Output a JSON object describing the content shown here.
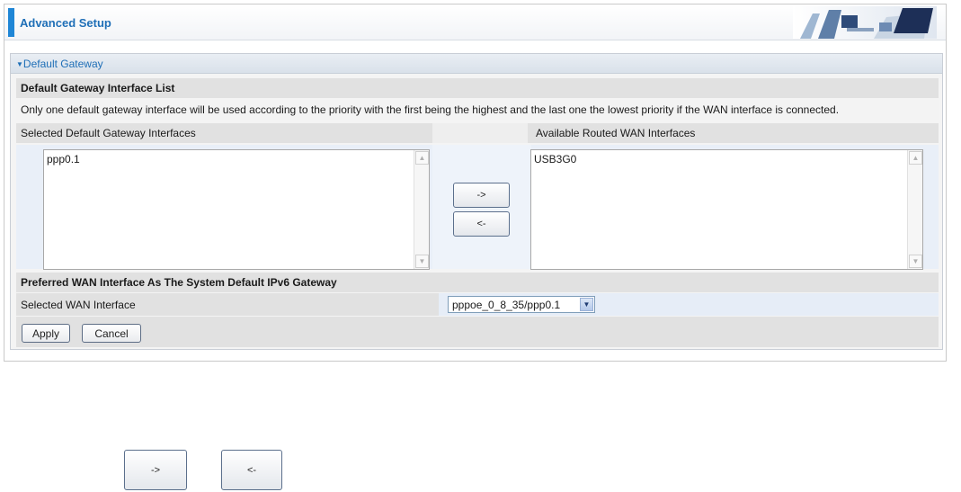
{
  "header": {
    "title": "Advanced Setup",
    "accent_color": "#1f86d6"
  },
  "panel": {
    "title": "Default Gateway",
    "title_icon": "triangle-down-icon"
  },
  "gateway_list": {
    "heading": "Default Gateway Interface List",
    "description": "Only one default gateway interface will be used according to the priority with the first being the highest and the last one the lowest priority if the WAN interface is connected.",
    "selected_label": "Selected Default Gateway Interfaces",
    "available_label": "Available Routed WAN Interfaces",
    "selected_items": [
      "ppp0.1"
    ],
    "available_items": [
      "USB3G0"
    ],
    "move_right_label": "->",
    "move_left_label": "<-"
  },
  "ipv6": {
    "heading": "Preferred WAN Interface As The System Default IPv6 Gateway",
    "field_label": "Selected WAN Interface",
    "selected_value": "pppoe_0_8_35/ppp0.1"
  },
  "actions": {
    "apply_label": "Apply",
    "cancel_label": "Cancel"
  },
  "standalone_buttons": {
    "move_right_label": "->",
    "move_left_label": "<-"
  }
}
